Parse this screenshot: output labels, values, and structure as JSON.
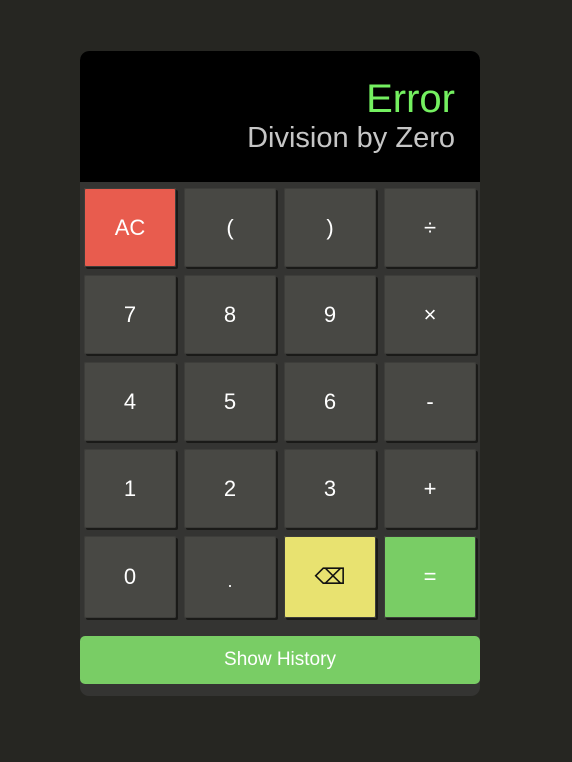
{
  "display": {
    "result": "Error",
    "expression": "Division by Zero"
  },
  "keys": {
    "clear": "AC",
    "open_paren": "(",
    "close_paren": ")",
    "divide": "÷",
    "seven": "7",
    "eight": "8",
    "nine": "9",
    "multiply": "×",
    "four": "4",
    "five": "5",
    "six": "6",
    "subtract": "-",
    "one": "1",
    "two": "2",
    "three": "3",
    "add": "+",
    "zero": "0",
    "decimal": ".",
    "backspace": "⌫",
    "equals": "="
  },
  "history_button": {
    "label": "Show History"
  },
  "colors": {
    "background": "#262622",
    "panel": "#343432",
    "display": "#000000",
    "result_text": "#74f060",
    "expression_text": "#c6c6c6",
    "key": "#484844",
    "clear_key": "#e85c4e",
    "backspace_key": "#e8e270",
    "equals_key": "#79cd65",
    "history_button": "#79cd65"
  }
}
